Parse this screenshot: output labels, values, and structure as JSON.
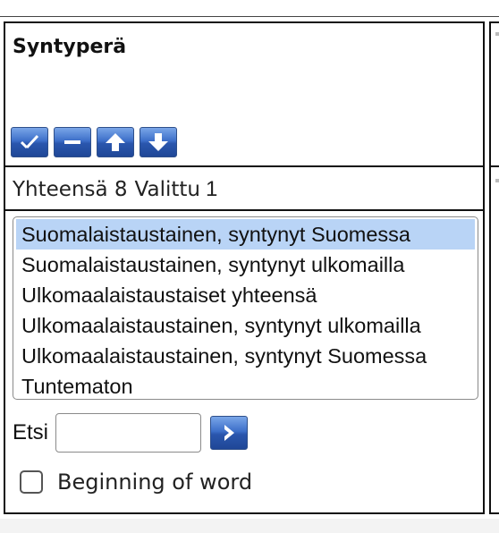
{
  "panel": {
    "title": "Syntyperä",
    "toolbar": [
      {
        "name": "select-all-icon"
      },
      {
        "name": "deselect-all-icon"
      },
      {
        "name": "arrow-up-icon"
      },
      {
        "name": "arrow-down-icon"
      }
    ],
    "summary": {
      "total_label": "Yhteensä 8",
      "selected_label": "Valittu",
      "selected_count": "1"
    },
    "options": [
      {
        "label": "Suomalaistaustainen, syntynyt Suomessa",
        "selected": true
      },
      {
        "label": "Suomalaistaustainen, syntynyt ulkomailla",
        "selected": false
      },
      {
        "label": "Ulkomaalaistaustaiset yhteensä",
        "selected": false
      },
      {
        "label": "Ulkomaalaistaustainen, syntynyt ulkomailla",
        "selected": false
      },
      {
        "label": "Ulkomaalaistaustainen, syntynyt Suomessa",
        "selected": false
      },
      {
        "label": "Tuntematon",
        "selected": false
      }
    ],
    "search": {
      "label": "Etsi",
      "value": "",
      "placeholder": ""
    },
    "beginning_of_word": {
      "label": "Beginning of word",
      "checked": false
    }
  },
  "colors": {
    "selected_row": "#b9d4f6",
    "button_blue": "#2a56ad",
    "border": "#111111"
  }
}
